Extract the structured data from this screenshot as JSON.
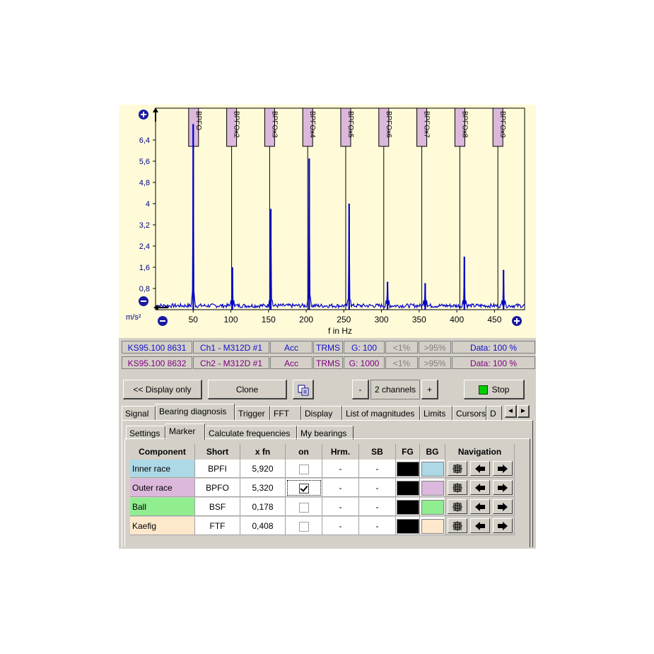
{
  "chart_data": {
    "type": "line",
    "xlabel": "f in Hz",
    "ylabel": "m/s²",
    "xlim": [
      0,
      490
    ],
    "ylim": [
      0,
      7.6
    ],
    "x_ticks": [
      50,
      100,
      150,
      200,
      250,
      300,
      350,
      400,
      450
    ],
    "y_ticks": [
      "0,8",
      "1,6",
      "2,4",
      "3,2",
      "4",
      "4,8",
      "5,6",
      "6,4"
    ],
    "y_tick_values": [
      0.8,
      1.6,
      2.4,
      3.2,
      4.0,
      4.8,
      5.6,
      6.4
    ],
    "series": [
      {
        "color": "#0000c8",
        "peaks": [
          {
            "x": 50,
            "y": 7.0
          },
          {
            "x": 102,
            "y": 1.6
          },
          {
            "x": 153,
            "y": 3.8
          },
          {
            "x": 204,
            "y": 5.7
          },
          {
            "x": 257,
            "y": 4.0
          },
          {
            "x": 308,
            "y": 1.05
          },
          {
            "x": 358,
            "y": 1.0
          },
          {
            "x": 410,
            "y": 2.0
          },
          {
            "x": 462,
            "y": 1.5
          }
        ],
        "noise_level": 0.15
      }
    ],
    "markers": [
      {
        "label": "BPFO",
        "x": 50.5
      },
      {
        "label": "BPFOx2",
        "x": 101
      },
      {
        "label": "BPFOx3",
        "x": 151.5
      },
      {
        "label": "BPFOx4",
        "x": 202
      },
      {
        "label": "BPFOx5",
        "x": 252.5
      },
      {
        "label": "BPFOx6",
        "x": 303
      },
      {
        "label": "BPFOx7",
        "x": 353.5
      },
      {
        "label": "BPFOx8",
        "x": 404
      },
      {
        "label": "BPFOx9",
        "x": 454.5
      }
    ],
    "grid": false
  },
  "channels": [
    {
      "device": "KS95.100 8631",
      "channel": "Ch1 - M312D #1",
      "mode": "Acc",
      "metric": "TRMS",
      "gain": "G: 100",
      "low": "<1%",
      "high": ">95%",
      "data": "Data: 100 %"
    },
    {
      "device": "KS95.100 8632",
      "channel": "Ch2 - M312D #1",
      "mode": "Acc",
      "metric": "TRMS",
      "gain": "G: 1000",
      "low": "<1%",
      "high": ">95%",
      "data": "Data: 100 %"
    }
  ],
  "toolbar": {
    "display_only": "<< Display only",
    "clone": "Clone",
    "minus": "-",
    "channels": "2 channels",
    "plus": "+",
    "stop": "Stop"
  },
  "tabs": [
    "Signal",
    "Bearing diagnosis",
    "Trigger",
    "FFT",
    "Display",
    "List of magnitudes",
    "Limits",
    "Cursors",
    "D"
  ],
  "subtabs": [
    "Settings",
    "Marker",
    "Calculate frequencies",
    "My bearings"
  ],
  "table": {
    "headers": [
      "Component",
      "Short",
      "x fn",
      "on",
      "Hrm.",
      "SB",
      "FG",
      "BG",
      "Navigation"
    ],
    "rows": [
      {
        "component": "Inner race",
        "short": "BPFI",
        "xfn": "5,920",
        "on": false,
        "hrm": "-",
        "sb": "-",
        "fg": "#000000",
        "bg": "#add8e6",
        "bg_label": "#add8e6"
      },
      {
        "component": "Outer race",
        "short": "BPFO",
        "xfn": "5,320",
        "on": true,
        "hrm": "-",
        "sb": "-",
        "fg": "#000000",
        "bg": "#dcb8dc",
        "bg_label": "#dcb8dc"
      },
      {
        "component": "Ball",
        "short": "BSF",
        "xfn": "0,178",
        "on": false,
        "hrm": "-",
        "sb": "-",
        "fg": "#000000",
        "bg": "#90ee90",
        "bg_label": "#90ee90"
      },
      {
        "component": "Kaefig",
        "short": "FTF",
        "xfn": "0,408",
        "on": false,
        "hrm": "-",
        "sb": "-",
        "fg": "#000000",
        "bg": "#fde8cc",
        "bg_label": "#fde8cc"
      }
    ]
  },
  "icons": {
    "zoom_in": "plus-circle-icon",
    "zoom_out": "minus-circle-icon",
    "nav_target": "crosshair-icon",
    "nav_left": "arrow-left-icon",
    "nav_right": "arrow-right-icon",
    "copy": "copy-icon"
  }
}
